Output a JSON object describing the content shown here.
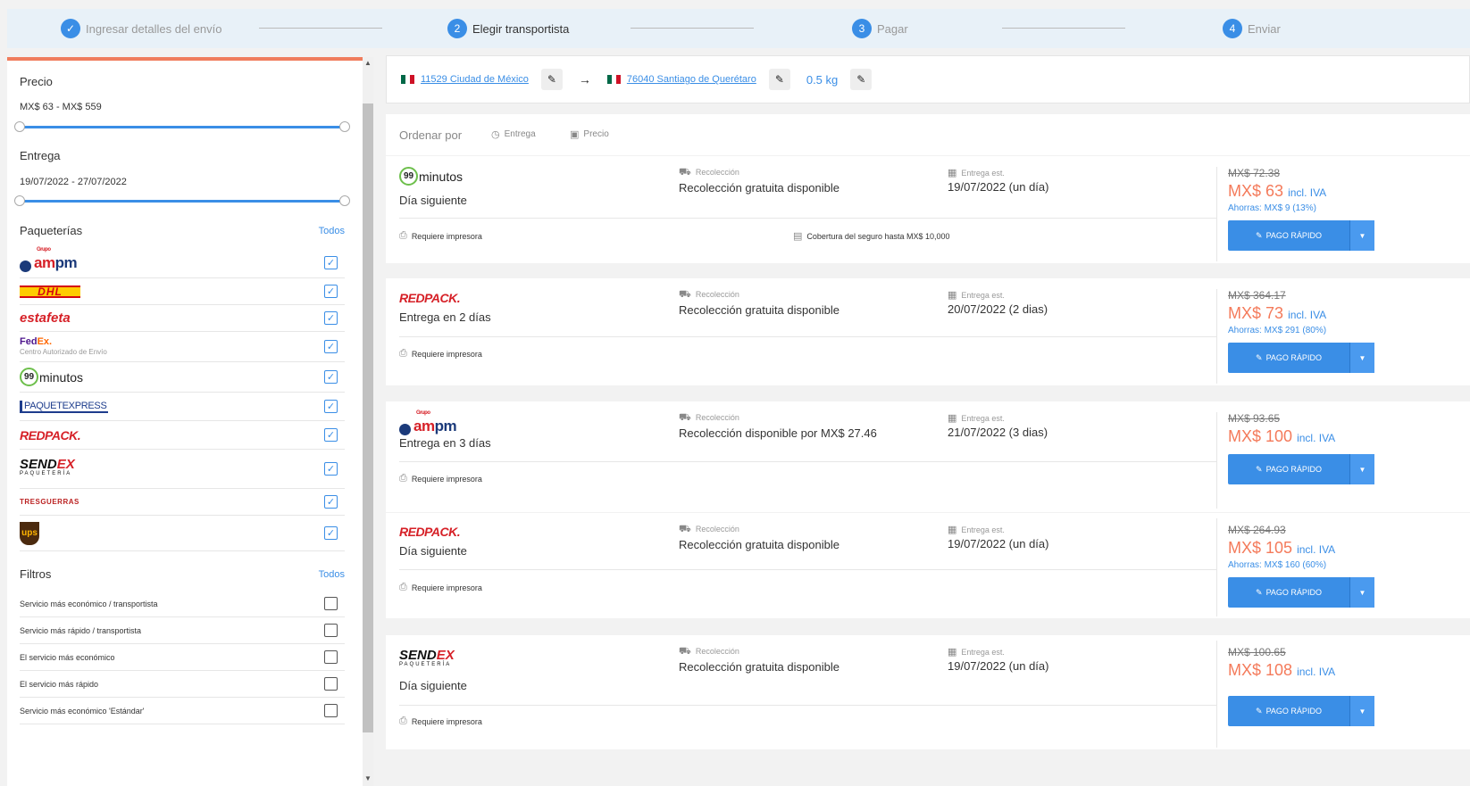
{
  "stepper": {
    "steps": [
      {
        "num": "✓",
        "label": "Ingresar detalles del envío"
      },
      {
        "num": "2",
        "label": "Elegir transportista"
      },
      {
        "num": "3",
        "label": "Pagar"
      },
      {
        "num": "4",
        "label": "Enviar"
      }
    ]
  },
  "sidebar": {
    "price_title": "Precio",
    "price_range": "MX$ 63 - MX$ 559",
    "delivery_title": "Entrega",
    "delivery_range": "19/07/2022 - 27/07/2022",
    "carriers_title": "Paqueterías",
    "carriers_all": "Todos",
    "carriers": {
      "ampm_group": "Grupo",
      "ampm_a": "am",
      "ampm_pm": "pm",
      "dhl": "DHL",
      "estafeta": "estafeta",
      "fedex_fe": "Fed",
      "fedex_ex": "Ex.",
      "fedex_sub": "Centro Autorizado de Envío",
      "m99_num": "99",
      "m99_txt": "minutos",
      "paquetexpress": "PAQUETEXPRESS",
      "redpack": "REDPACK.",
      "sendex_send": "SEND",
      "sendex_ex": "EX",
      "sendex_sub": "PAQUETERÍA",
      "tres": "TRESGUERRAS",
      "ups": "ups"
    },
    "filters_title": "Filtros",
    "filters_all": "Todos",
    "filters": [
      "Servicio más económico / transportista",
      "Servicio más rápido / transportista",
      "El servicio más económico",
      "El servicio más rápido",
      "Servicio más económico 'Estándar'"
    ]
  },
  "topbar": {
    "origin": "11529 Ciudad de México",
    "destination": "76040 Santiago de Querétaro",
    "weight": "0.5 kg"
  },
  "sort": {
    "label": "Ordenar por",
    "delivery": "Entrega",
    "price": "Precio"
  },
  "labels": {
    "pickup": "Recolección",
    "delivery_est": "Entrega est.",
    "printer": "Requiere impresora",
    "pay": "PAGO RÁPIDO",
    "iva": "incl. IVA"
  },
  "offers": [
    {
      "service": "Día siguiente",
      "pickup": "Recolección gratuita disponible",
      "delivery": "19/07/2022  (un día)",
      "insurance": "Cobertura del seguro hasta MX$ 10,000",
      "old_price": "MX$ 72.38",
      "price": "MX$ 63",
      "savings": "Ahorras: MX$ 9 (13%)"
    },
    {
      "service": "Entrega en 2 días",
      "pickup": "Recolección gratuita disponible",
      "delivery": "20/07/2022  (2 dias)",
      "old_price": "MX$ 364.17",
      "price": "MX$ 73",
      "savings": "Ahorras: MX$ 291 (80%)"
    },
    {
      "service": "Entrega en 3 días",
      "pickup": "Recolección disponible por MX$ 27.46",
      "delivery": "21/07/2022  (3 dias)",
      "old_price": "MX$ 93.65",
      "price": "MX$ 100"
    },
    {
      "service": "Día siguiente",
      "pickup": "Recolección gratuita disponible",
      "delivery": "19/07/2022  (un día)",
      "old_price": "MX$ 264.93",
      "price": "MX$ 105",
      "savings": "Ahorras: MX$ 160 (60%)"
    },
    {
      "service": "Día siguiente",
      "pickup": "Recolección gratuita disponible",
      "delivery": "19/07/2022  (un día)",
      "old_price": "MX$ 100.65",
      "price": "MX$ 108"
    }
  ]
}
